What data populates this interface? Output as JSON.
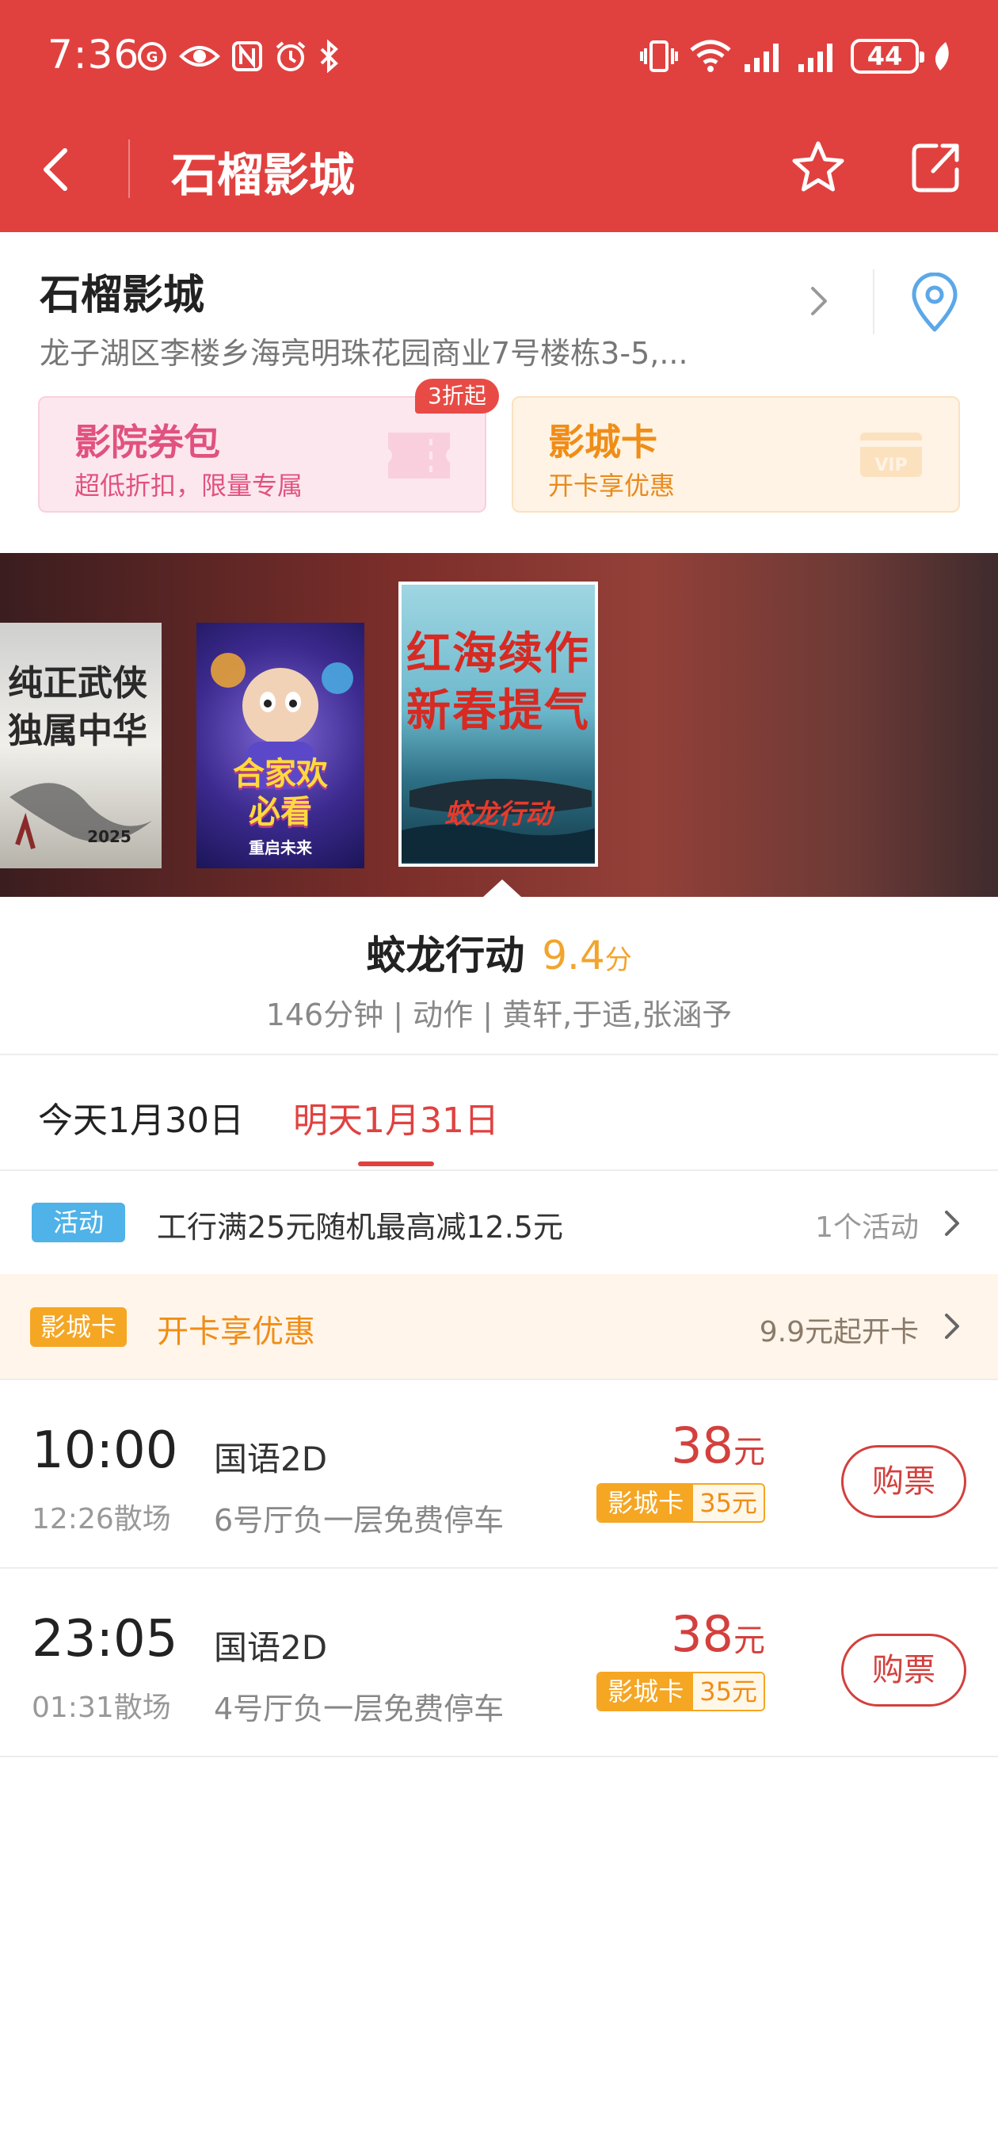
{
  "status_bar": {
    "time": "7:36",
    "battery": "44",
    "left_icons": [
      "app-badge-icon",
      "eye-icon",
      "nfc-icon",
      "alarm-icon",
      "bluetooth-icon"
    ],
    "right_icons": [
      "vibrate-icon",
      "wifi-icon",
      "signal-icon",
      "signal-icon",
      "battery-icon",
      "leaf-icon"
    ]
  },
  "nav": {
    "title": "石榴影城"
  },
  "cinema": {
    "name": "石榴影城",
    "address": "龙子湖区李楼乡海亮明珠花园商业7号楼栋3-5,..."
  },
  "promos": {
    "coupon": {
      "title": "影院券包",
      "subtitle": "超低折扣，限量专属",
      "badge": "3折起"
    },
    "card": {
      "title": "影城卡",
      "subtitle": "开卡享优惠",
      "deco": "VIP"
    }
  },
  "posters": [
    {
      "line1": "纯正武侠",
      "line2": "独属中华",
      "year": "2025"
    },
    {
      "line1": "合家欢",
      "line2": "必看",
      "subtitle": "重启未来"
    },
    {
      "line1": "红海续作",
      "line2": "新春提气",
      "logo": "蛟龙行动"
    }
  ],
  "movie": {
    "title": "蛟龙行动",
    "score": "9.4",
    "score_unit": "分",
    "meta": "146分钟 | 动作 | 黄轩,于适,张涵予"
  },
  "dates": {
    "today": "今天1月30日",
    "tomorrow": "明天1月31日"
  },
  "activity": {
    "tag": "活动",
    "text": "工行满25元随机最高减12.5元",
    "count": "1个活动"
  },
  "member_card": {
    "tag": "影城卡",
    "text": "开卡享优惠",
    "price": "9.9元起开卡"
  },
  "showtimes": [
    {
      "time": "10:00",
      "end": "12:26散场",
      "lang": "国语2D",
      "hall": "6号厅负一层免费停车",
      "price": "38",
      "price_unit": "元",
      "card_label": "影城卡",
      "card_price": "35元",
      "buy": "购票"
    },
    {
      "time": "23:05",
      "end": "01:31散场",
      "lang": "国语2D",
      "hall": "4号厅负一层免费停车",
      "price": "38",
      "price_unit": "元",
      "card_label": "影城卡",
      "card_price": "35元",
      "buy": "购票"
    }
  ],
  "colors": {
    "brand_red": "#e0413f",
    "price_red": "#d3403d",
    "card_orange": "#f5a623",
    "activity_blue": "#4fb2e8",
    "score_yellow": "#f2a42d"
  }
}
